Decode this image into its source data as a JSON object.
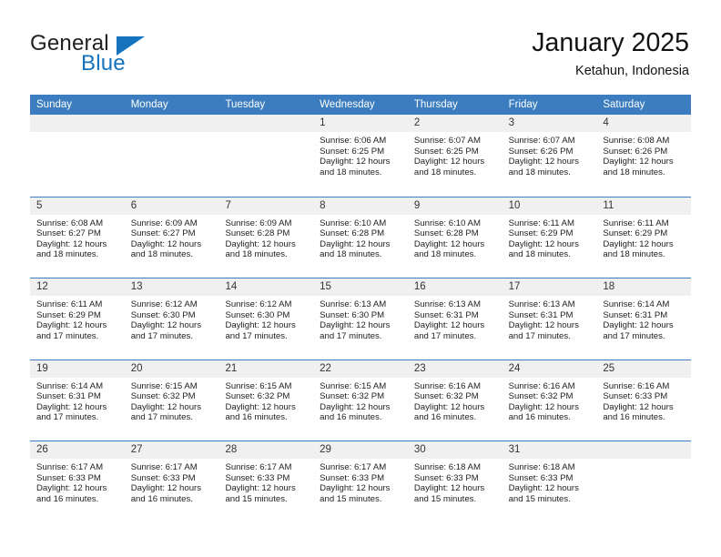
{
  "brand": {
    "name_primary": "General",
    "name_secondary": "Blue"
  },
  "header": {
    "title": "January 2025",
    "location": "Ketahun, Indonesia"
  },
  "colors": {
    "header_blue": "#3b7dbf",
    "brand_blue": "#1573be",
    "daynum_band": "#f0f0f0"
  },
  "weekdays": [
    "Sunday",
    "Monday",
    "Tuesday",
    "Wednesday",
    "Thursday",
    "Friday",
    "Saturday"
  ],
  "weeks": [
    [
      {
        "day": "",
        "sunrise": "",
        "sunset": "",
        "daylight1": "",
        "daylight2": ""
      },
      {
        "day": "",
        "sunrise": "",
        "sunset": "",
        "daylight1": "",
        "daylight2": ""
      },
      {
        "day": "",
        "sunrise": "",
        "sunset": "",
        "daylight1": "",
        "daylight2": ""
      },
      {
        "day": "1",
        "sunrise": "Sunrise: 6:06 AM",
        "sunset": "Sunset: 6:25 PM",
        "daylight1": "Daylight: 12 hours",
        "daylight2": "and 18 minutes."
      },
      {
        "day": "2",
        "sunrise": "Sunrise: 6:07 AM",
        "sunset": "Sunset: 6:25 PM",
        "daylight1": "Daylight: 12 hours",
        "daylight2": "and 18 minutes."
      },
      {
        "day": "3",
        "sunrise": "Sunrise: 6:07 AM",
        "sunset": "Sunset: 6:26 PM",
        "daylight1": "Daylight: 12 hours",
        "daylight2": "and 18 minutes."
      },
      {
        "day": "4",
        "sunrise": "Sunrise: 6:08 AM",
        "sunset": "Sunset: 6:26 PM",
        "daylight1": "Daylight: 12 hours",
        "daylight2": "and 18 minutes."
      }
    ],
    [
      {
        "day": "5",
        "sunrise": "Sunrise: 6:08 AM",
        "sunset": "Sunset: 6:27 PM",
        "daylight1": "Daylight: 12 hours",
        "daylight2": "and 18 minutes."
      },
      {
        "day": "6",
        "sunrise": "Sunrise: 6:09 AM",
        "sunset": "Sunset: 6:27 PM",
        "daylight1": "Daylight: 12 hours",
        "daylight2": "and 18 minutes."
      },
      {
        "day": "7",
        "sunrise": "Sunrise: 6:09 AM",
        "sunset": "Sunset: 6:28 PM",
        "daylight1": "Daylight: 12 hours",
        "daylight2": "and 18 minutes."
      },
      {
        "day": "8",
        "sunrise": "Sunrise: 6:10 AM",
        "sunset": "Sunset: 6:28 PM",
        "daylight1": "Daylight: 12 hours",
        "daylight2": "and 18 minutes."
      },
      {
        "day": "9",
        "sunrise": "Sunrise: 6:10 AM",
        "sunset": "Sunset: 6:28 PM",
        "daylight1": "Daylight: 12 hours",
        "daylight2": "and 18 minutes."
      },
      {
        "day": "10",
        "sunrise": "Sunrise: 6:11 AM",
        "sunset": "Sunset: 6:29 PM",
        "daylight1": "Daylight: 12 hours",
        "daylight2": "and 18 minutes."
      },
      {
        "day": "11",
        "sunrise": "Sunrise: 6:11 AM",
        "sunset": "Sunset: 6:29 PM",
        "daylight1": "Daylight: 12 hours",
        "daylight2": "and 18 minutes."
      }
    ],
    [
      {
        "day": "12",
        "sunrise": "Sunrise: 6:11 AM",
        "sunset": "Sunset: 6:29 PM",
        "daylight1": "Daylight: 12 hours",
        "daylight2": "and 17 minutes."
      },
      {
        "day": "13",
        "sunrise": "Sunrise: 6:12 AM",
        "sunset": "Sunset: 6:30 PM",
        "daylight1": "Daylight: 12 hours",
        "daylight2": "and 17 minutes."
      },
      {
        "day": "14",
        "sunrise": "Sunrise: 6:12 AM",
        "sunset": "Sunset: 6:30 PM",
        "daylight1": "Daylight: 12 hours",
        "daylight2": "and 17 minutes."
      },
      {
        "day": "15",
        "sunrise": "Sunrise: 6:13 AM",
        "sunset": "Sunset: 6:30 PM",
        "daylight1": "Daylight: 12 hours",
        "daylight2": "and 17 minutes."
      },
      {
        "day": "16",
        "sunrise": "Sunrise: 6:13 AM",
        "sunset": "Sunset: 6:31 PM",
        "daylight1": "Daylight: 12 hours",
        "daylight2": "and 17 minutes."
      },
      {
        "day": "17",
        "sunrise": "Sunrise: 6:13 AM",
        "sunset": "Sunset: 6:31 PM",
        "daylight1": "Daylight: 12 hours",
        "daylight2": "and 17 minutes."
      },
      {
        "day": "18",
        "sunrise": "Sunrise: 6:14 AM",
        "sunset": "Sunset: 6:31 PM",
        "daylight1": "Daylight: 12 hours",
        "daylight2": "and 17 minutes."
      }
    ],
    [
      {
        "day": "19",
        "sunrise": "Sunrise: 6:14 AM",
        "sunset": "Sunset: 6:31 PM",
        "daylight1": "Daylight: 12 hours",
        "daylight2": "and 17 minutes."
      },
      {
        "day": "20",
        "sunrise": "Sunrise: 6:15 AM",
        "sunset": "Sunset: 6:32 PM",
        "daylight1": "Daylight: 12 hours",
        "daylight2": "and 17 minutes."
      },
      {
        "day": "21",
        "sunrise": "Sunrise: 6:15 AM",
        "sunset": "Sunset: 6:32 PM",
        "daylight1": "Daylight: 12 hours",
        "daylight2": "and 16 minutes."
      },
      {
        "day": "22",
        "sunrise": "Sunrise: 6:15 AM",
        "sunset": "Sunset: 6:32 PM",
        "daylight1": "Daylight: 12 hours",
        "daylight2": "and 16 minutes."
      },
      {
        "day": "23",
        "sunrise": "Sunrise: 6:16 AM",
        "sunset": "Sunset: 6:32 PM",
        "daylight1": "Daylight: 12 hours",
        "daylight2": "and 16 minutes."
      },
      {
        "day": "24",
        "sunrise": "Sunrise: 6:16 AM",
        "sunset": "Sunset: 6:32 PM",
        "daylight1": "Daylight: 12 hours",
        "daylight2": "and 16 minutes."
      },
      {
        "day": "25",
        "sunrise": "Sunrise: 6:16 AM",
        "sunset": "Sunset: 6:33 PM",
        "daylight1": "Daylight: 12 hours",
        "daylight2": "and 16 minutes."
      }
    ],
    [
      {
        "day": "26",
        "sunrise": "Sunrise: 6:17 AM",
        "sunset": "Sunset: 6:33 PM",
        "daylight1": "Daylight: 12 hours",
        "daylight2": "and 16 minutes."
      },
      {
        "day": "27",
        "sunrise": "Sunrise: 6:17 AM",
        "sunset": "Sunset: 6:33 PM",
        "daylight1": "Daylight: 12 hours",
        "daylight2": "and 16 minutes."
      },
      {
        "day": "28",
        "sunrise": "Sunrise: 6:17 AM",
        "sunset": "Sunset: 6:33 PM",
        "daylight1": "Daylight: 12 hours",
        "daylight2": "and 15 minutes."
      },
      {
        "day": "29",
        "sunrise": "Sunrise: 6:17 AM",
        "sunset": "Sunset: 6:33 PM",
        "daylight1": "Daylight: 12 hours",
        "daylight2": "and 15 minutes."
      },
      {
        "day": "30",
        "sunrise": "Sunrise: 6:18 AM",
        "sunset": "Sunset: 6:33 PM",
        "daylight1": "Daylight: 12 hours",
        "daylight2": "and 15 minutes."
      },
      {
        "day": "31",
        "sunrise": "Sunrise: 6:18 AM",
        "sunset": "Sunset: 6:33 PM",
        "daylight1": "Daylight: 12 hours",
        "daylight2": "and 15 minutes."
      },
      {
        "day": "",
        "sunrise": "",
        "sunset": "",
        "daylight1": "",
        "daylight2": ""
      }
    ]
  ]
}
